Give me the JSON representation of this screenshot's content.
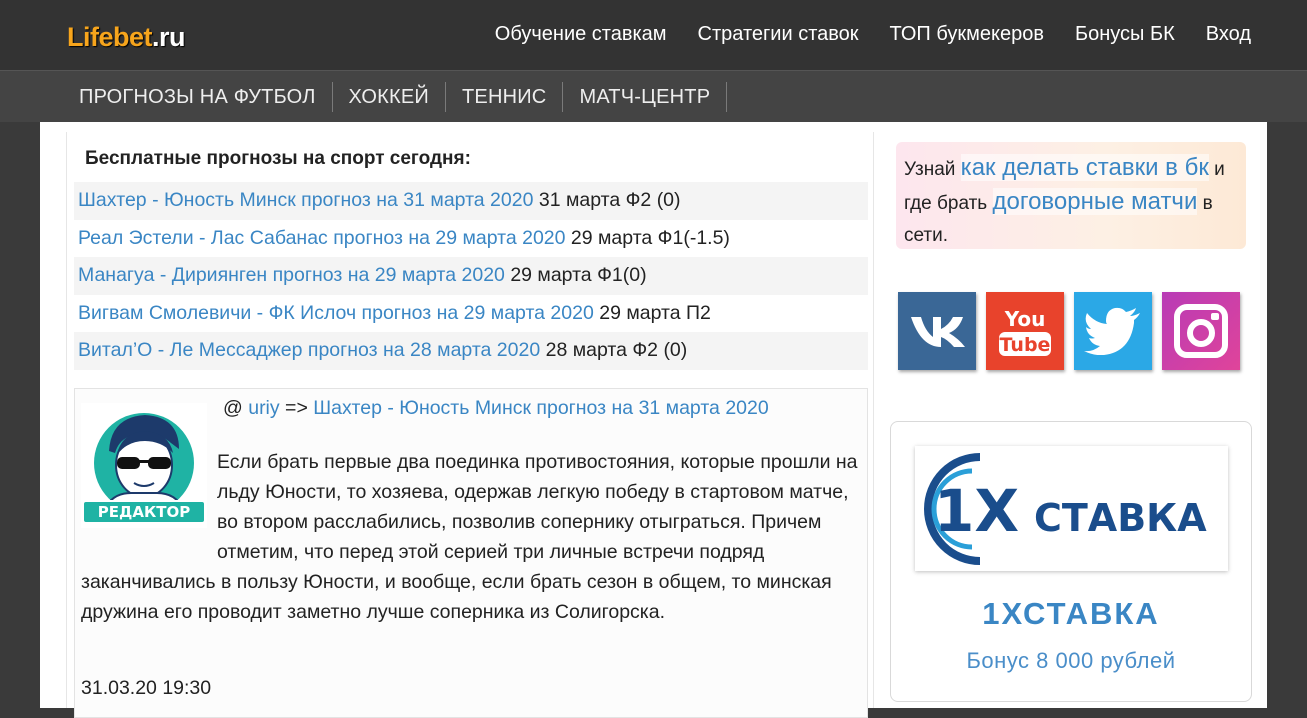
{
  "header": {
    "logo_part1": "Lifebet",
    "logo_part2": ".ru",
    "nav": [
      "Обучение ставкам",
      "Стратегии ставок",
      "ТОП букмекеров",
      "Бонусы БК",
      "Вход"
    ]
  },
  "secondary_nav": [
    "ПРОГНОЗЫ НА ФУТБОЛ",
    "ХОККЕЙ",
    "ТЕННИС",
    "МАТЧ-ЦЕНТР"
  ],
  "main": {
    "heading": "Бесплатные прогнозы на спорт сегодня:",
    "predictions": [
      {
        "title": "Шахтер - Юность Минск прогноз на 31 марта 2020",
        "info": " 31 марта Ф2 (0)"
      },
      {
        "title": "Реал Эстели - Лас Сабанас прогноз на 29 марта 2020",
        "info": " 29 марта Ф1(-1.5)"
      },
      {
        "title": "Манагуа - Дириянген прогноз на 29 марта 2020",
        "info": " 29 марта Ф1(0)"
      },
      {
        "title": "Вигвам Смолевичи - ФК Ислоч прогноз на 29 марта 2020",
        "info": " 29 марта П2"
      },
      {
        "title": "Витал’О - Ле Мессаджер прогноз на 28 марта 2020",
        "info": " 28 марта Ф2 (0)"
      }
    ],
    "comment": {
      "at": "@ ",
      "author": "uriy",
      "arrow": " => ",
      "link": "Шахтер - Юность Минск прогноз на 31 марта 2020",
      "avatar_label": "РЕДАКТОР",
      "text": "Если брать первые два поединка противостояния, которые прошли на льду Юности, то хозяева, одержав легкую победу в стартовом матче, во втором расслабились, позволив сопернику отыграться. Причем отметим, что перед этой серией три личные встречи подряд заканчивались в пользу Юности, и вообще, если брать сезон в общем, то минская дружина его проводит заметно лучше соперника из Солигорска.",
      "date": "31.03.20 19:30"
    }
  },
  "sidebar": {
    "promo": {
      "t1": "Узнай ",
      "link1": "как делать ставки в бк",
      "t2": " и где брать ",
      "link2": "договорные матчи",
      "t3": " в сети."
    },
    "socials": [
      "vk-icon",
      "youtube-icon",
      "twitter-icon",
      "instagram-icon"
    ],
    "youtube_label_1": "You",
    "youtube_label_2": "Tube",
    "bookmaker": {
      "logo_prefix": "1X",
      "logo_suffix": "СТАВКА",
      "name": "1ХСТАВКА",
      "bonus": "Бонус 8 000 рублей"
    },
    "colors": {
      "link": "#3a86c4",
      "logo_orange": "#f7a51c",
      "bk_blue": "#1a4d8c"
    }
  }
}
